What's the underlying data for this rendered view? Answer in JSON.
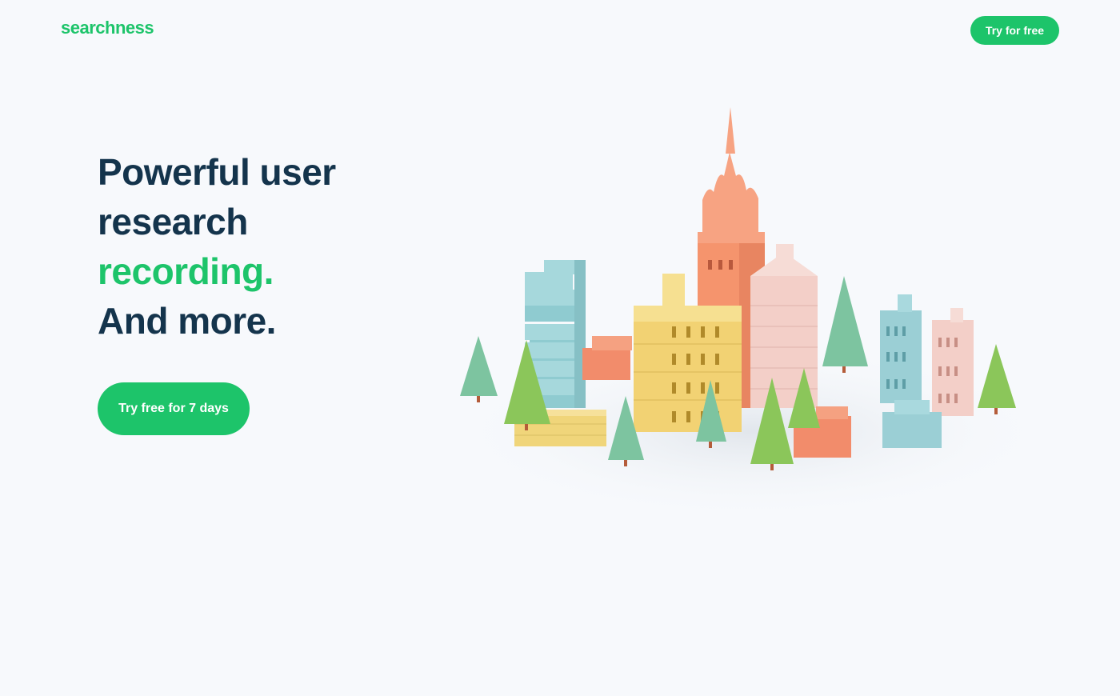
{
  "brand": {
    "logo_text": "searchness",
    "accent": "#1dc46a",
    "dark_text": "#14344c"
  },
  "header": {
    "cta_label": "Try for free"
  },
  "hero": {
    "line1": "Powerful user",
    "line2": "research",
    "line3": "recording.",
    "line4": "And more.",
    "cta_label": "Try free for 7 days"
  },
  "illustration": {
    "name": "isometric-city"
  }
}
